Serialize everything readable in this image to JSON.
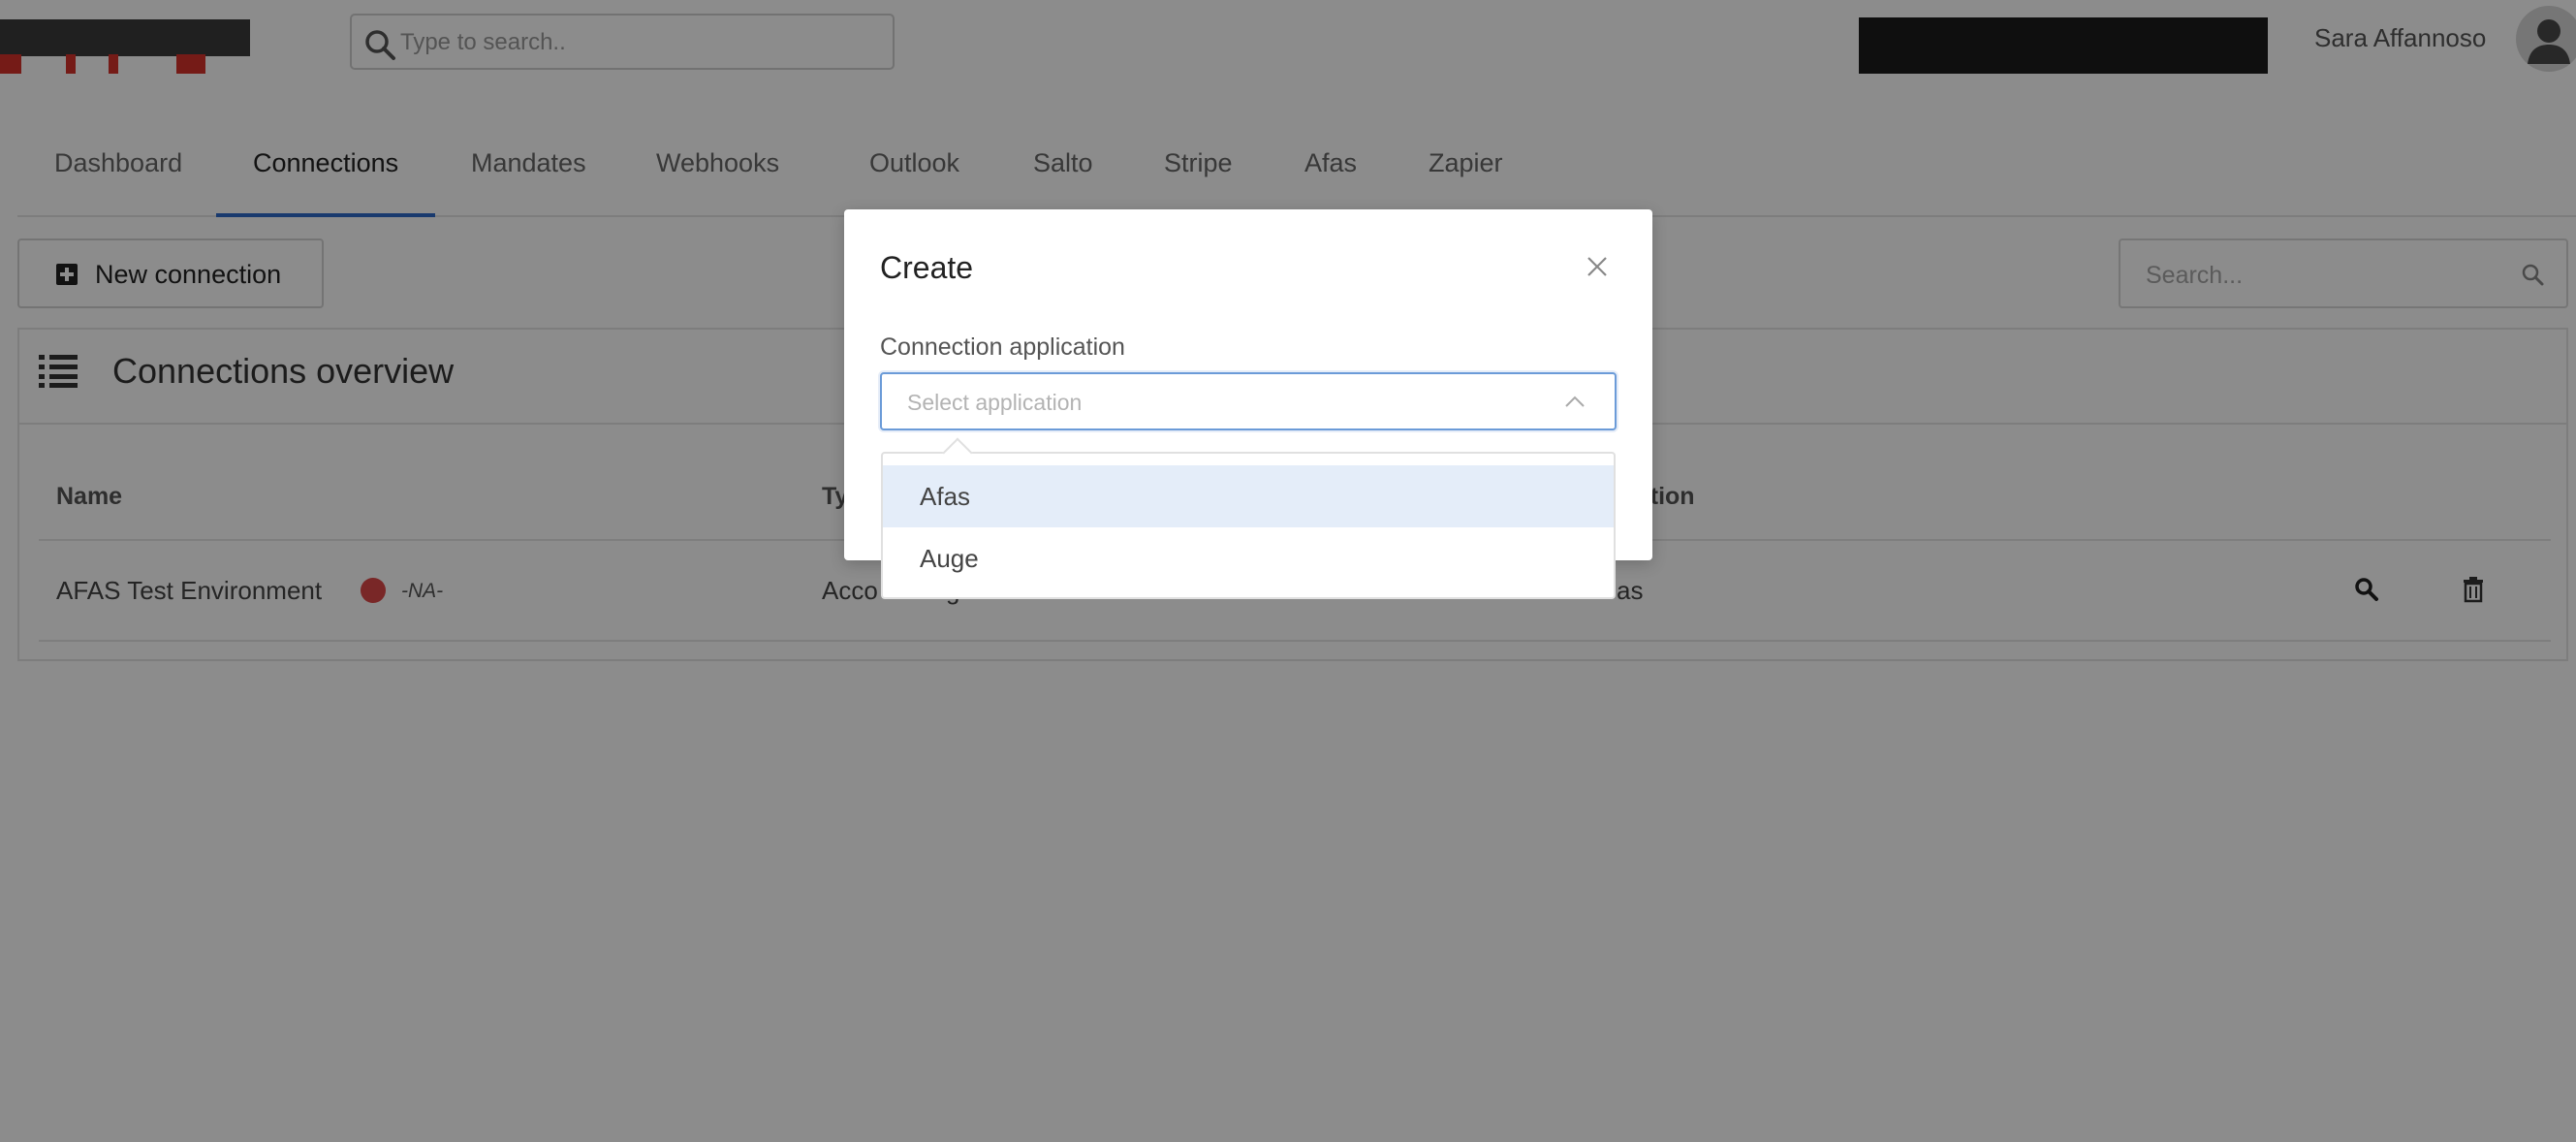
{
  "topbar": {
    "search_placeholder": "Type to search..",
    "username": "Sara Affannoso"
  },
  "tabs": [
    {
      "label": "Dashboard",
      "active": false
    },
    {
      "label": "Connections",
      "active": true
    },
    {
      "label": "Mandates",
      "active": false
    },
    {
      "label": "Webhooks",
      "active": false
    },
    {
      "label": "Outlook",
      "active": false
    },
    {
      "label": "Salto",
      "active": false
    },
    {
      "label": "Stripe",
      "active": false
    },
    {
      "label": "Afas",
      "active": false
    },
    {
      "label": "Zapier",
      "active": false
    }
  ],
  "toolbar": {
    "new_connection_label": "New connection",
    "search_placeholder": "Search..."
  },
  "panel": {
    "title": "Connections overview",
    "columns": {
      "name": "Name",
      "type": "Ty",
      "application": "ication"
    },
    "rows": [
      {
        "name": "AFAS Test Environment",
        "status": "-NA-",
        "type": "Acco",
        "type_tail": "g",
        "application": "as"
      }
    ]
  },
  "modal": {
    "title": "Create",
    "field_label": "Connection application",
    "select_placeholder": "Select application",
    "options": [
      "Afas",
      "Auge"
    ]
  },
  "colors": {
    "accent": "#2f6bc9",
    "status_red": "#dc4747",
    "highlight": "#e4edf9"
  }
}
